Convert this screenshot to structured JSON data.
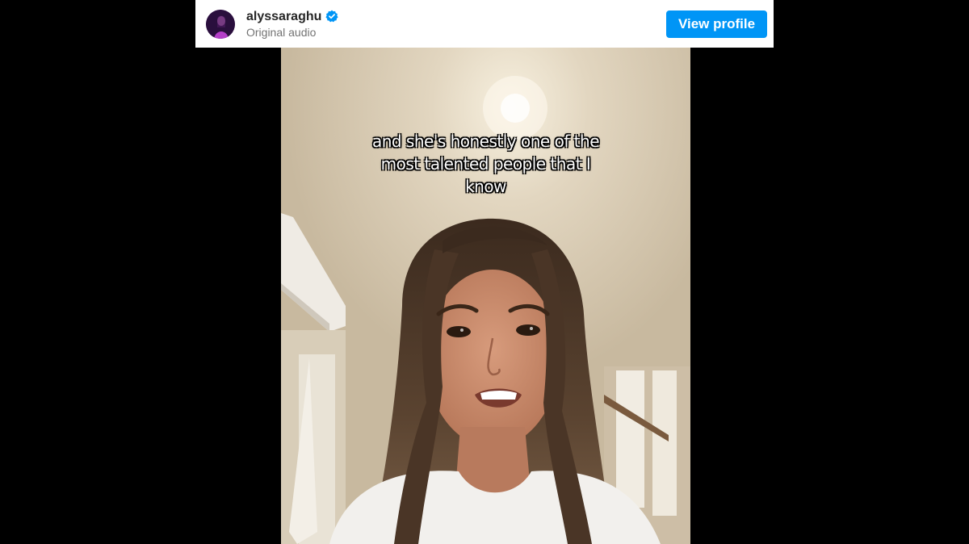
{
  "header": {
    "username": "alyssaraghu",
    "audio_label": "Original audio",
    "view_profile_label": "View profile",
    "avatar_icon": "profile-avatar",
    "verified_icon": "verified-badge-icon"
  },
  "video": {
    "caption_lines": [
      "and she's honestly one of the",
      "most talented people that I",
      "know"
    ]
  },
  "colors": {
    "background": "#000000",
    "header_bg": "#ffffff",
    "button": "#0095f6",
    "verified": "#0095f6",
    "username": "#262626",
    "subtext": "#737373"
  }
}
